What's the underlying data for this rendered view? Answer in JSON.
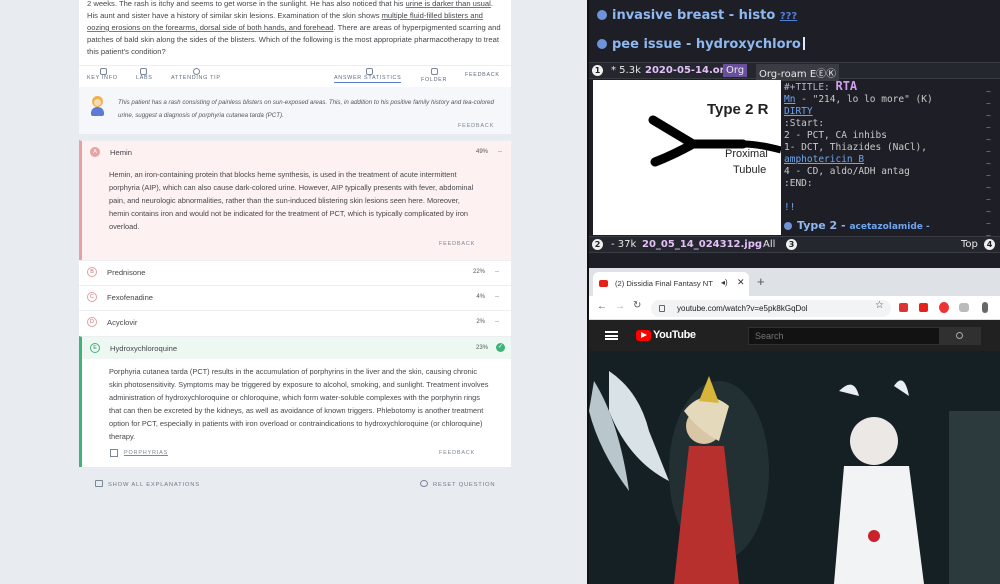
{
  "question": {
    "parts": [
      {
        "t": "2 weeks. The rash is itchy and seems to get worse in the sunlight. He has also noticed that his ",
        "u": false
      },
      {
        "t": "urine is darker than usual",
        "u": true
      },
      {
        "t": ". His aunt and sister have a history of similar skin lesions. Examination of the skin shows ",
        "u": false
      },
      {
        "t": "multiple fluid-filled blisters and oozing erosions on the forearms, dorsal side of both hands, and forehead",
        "u": true
      },
      {
        "t": ". There are areas of hyperpigmented scarring and patches of bald skin along the sides of the blisters. Which of the following is the most appropriate pharmacotherapy to treat this patient's condition?",
        "u": false
      }
    ]
  },
  "toolbar": {
    "key_info": "KEY INFO",
    "labs": "LABS",
    "attending_tip": "ATTENDING TIP",
    "answer_statistics": "ANSWER STATISTICS",
    "folder": "FOLDER",
    "feedback": "FEEDBACK"
  },
  "explanation_box": {
    "text": "This patient has a rash consisting of painless blisters on sun-exposed areas. This, in addition to his positive family history and tea-colored urine, suggest a diagnosis of porphyria cutanea tarda (PCT).",
    "feedback": "FEEDBACK"
  },
  "options": [
    {
      "letter": "A",
      "label": "Hemin",
      "pct": "49%",
      "desc": "Hemin, an iron-containing protein that blocks heme synthesis, is used in the treatment of acute intermittent porphyria (AIP), which can also cause dark-colored urine. However, AIP typically presents with fever, abdominal pain, and neurologic abnormalities, rather than the sun-induced blistering skin lesions seen here. Moreover, hemin contains iron and would not be indicated for the treatment of PCT, which is typically complicated by iron overload.",
      "feedback": "FEEDBACK"
    },
    {
      "letter": "B",
      "label": "Prednisone",
      "pct": "22%"
    },
    {
      "letter": "C",
      "label": "Fexofenadine",
      "pct": "4%"
    },
    {
      "letter": "D",
      "label": "Acyclovir",
      "pct": "2%"
    },
    {
      "letter": "E",
      "label": "Hydroxychloroquine",
      "pct": "23%",
      "desc": "Porphyria cutanea tarda (PCT) results in the accumulation of porphyrins in the liver and the skin, causing chronic skin photosensitivity. Symptoms may be triggered by exposure to alcohol, smoking, and sunlight. Treatment involves administration of hydroxychloroquine or chloroquine, which form water-soluble complexes with the porphyrin rings that can then be excreted by the kidneys, as well as avoidance of known triggers. Phlebotomy is another treatment option for PCT, especially in patients with iron overload or contraindications to hydroxychloroquine (or chloroquine) therapy.",
      "link": "PORPHYRIAS",
      "feedback": "FEEDBACK"
    }
  ],
  "dash": "--",
  "bottom": {
    "show_all": "SHOW ALL EXPLANATIONS",
    "reset": "RESET QUESTION"
  },
  "emacs": {
    "headline1": "invasive breast - histo",
    "headline1_tail": "???",
    "headline2": "pee issue - hydroxychloro",
    "modeline_top": {
      "num": "1",
      "status": "* 5.3k",
      "file": "2020-05-14.org",
      "mode1": "Org",
      "mode2": "Org-roam EⒺⓀ"
    },
    "image_text1": "Type 2 R",
    "image_text2": "Proximal",
    "image_text3": "Tubule",
    "org_lines": [
      {
        "k": "title",
        "a": "#+TITLE: ",
        "b": "RTA"
      },
      {
        "k": "plain",
        "a": "Mn",
        "b": " - \"214, lo lo more\" (K)"
      },
      {
        "k": "dirty",
        "a": "DIRTY",
        "b": ""
      },
      {
        "k": "plain",
        "a": ":Start:",
        "b": ""
      },
      {
        "k": "plain",
        "a": "2 - PCT, CA inhibs",
        "b": ""
      },
      {
        "k": "link",
        "a": "1- DCT, Thiazides (NaCl), ",
        "b": "amphotericin B"
      },
      {
        "k": "plain",
        "a": "4 - CD, aldo/ADH antag",
        "b": ""
      },
      {
        "k": "plain",
        "a": ":END:",
        "b": ""
      },
      {
        "k": "plain",
        "a": "",
        "b": ""
      },
      {
        "k": "plain",
        "a": "!!",
        "b": ""
      }
    ],
    "org_heading": "Type 2 -",
    "org_heading_tail": "acetazolamide -",
    "tildes": "~\n~\n~\n~\n~\n~\n~\n~\n~\n~\n~\n~\n~",
    "modeline_bottom": {
      "num": "2",
      "status": "- 37k",
      "file": "20_05_14_024312.jpg",
      "pos": "All",
      "num2": "3",
      "top": "Top",
      "num3": "4"
    }
  },
  "browser": {
    "tab_title": "(2) Dissidia Final Fantasy NT",
    "url": "youtube.com/watch?v=e5pk8kGqDol",
    "yt_logo": "YouTube",
    "search_placeholder": "Search"
  },
  "colors": {
    "wrong": "#e8a0a0",
    "correct": "#3fb37a",
    "accent": "#5b7bd5"
  }
}
